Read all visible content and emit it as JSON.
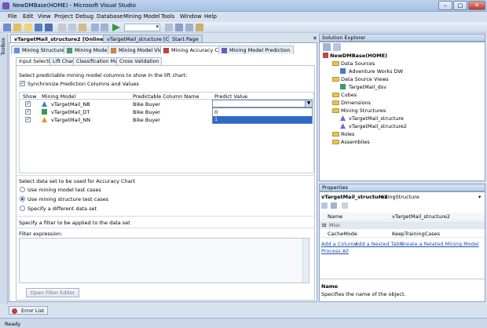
{
  "window": {
    "title": "NewDMBase(HOME) - Microsoft Visual Studio"
  },
  "menu": [
    "File",
    "Edit",
    "View",
    "Project",
    "Debug",
    "Database",
    "Mining Model",
    "Tools",
    "Window",
    "Help"
  ],
  "toolbox_label": "Toolbox",
  "doc_tabs": [
    {
      "label": "vTargetMail_structure2 [Online]",
      "active": true
    },
    {
      "label": "vTargetMail_structure [Online]",
      "active": false
    },
    {
      "label": "Start Page",
      "active": false
    }
  ],
  "designer_tabs": [
    "Mining Structure",
    "Mining Models",
    "Mining Model Viewer",
    "Mining Accuracy Chart",
    "Mining Model Prediction"
  ],
  "designer_active": "Mining Accuracy Chart",
  "sub_tabs": [
    "Input Selection",
    "Lift Chart",
    "Classification Matrix",
    "Cross Validation"
  ],
  "input": {
    "instruction": "Select predictable mining model columns to show in the lift chart:",
    "sync_label": "Synchronize Prediction Columns and Values",
    "columns": [
      "Show",
      "Mining Model",
      "Predictable Column Name",
      "Predict Value"
    ],
    "rows": [
      {
        "model": "vTargetMail_NB",
        "column": "Bike Buyer",
        "value": ""
      },
      {
        "model": "vTargetMail_DT",
        "column": "Bike Buyer",
        "value": ""
      },
      {
        "model": "vTargetMail_NN",
        "column": "Bike Buyer",
        "value": ""
      }
    ],
    "dropdown_options": [
      "0",
      "1"
    ],
    "dataset_heading": "Select data set to be used for Accuracy Chart",
    "dataset_options": [
      "Use mining model test cases",
      "Use mining structure test cases",
      "Specify a different data set"
    ],
    "dataset_selected": 1,
    "filter_heading": "Specify a filter to be applied to the data set",
    "filter_label": "Filter expression:",
    "filter_button": "Open Filter Editor"
  },
  "solution_explorer": {
    "title": "Solution Explorer",
    "items": [
      {
        "label": "NewDMBase(HOME)",
        "level": 0
      },
      {
        "label": "Data Sources",
        "level": 1
      },
      {
        "label": "Adventure Works DW",
        "level": 2
      },
      {
        "label": "Data Source Views",
        "level": 1
      },
      {
        "label": "TargetMail_dsv",
        "level": 2
      },
      {
        "label": "Cubes",
        "level": 1
      },
      {
        "label": "Dimensions",
        "level": 1
      },
      {
        "label": "Mining Structures",
        "level": 1
      },
      {
        "label": "vTargetMail_structure",
        "level": 2
      },
      {
        "label": "vTargetMail_structure2",
        "level": 2
      },
      {
        "label": "Roles",
        "level": 1
      },
      {
        "label": "Assemblies",
        "level": 1
      }
    ]
  },
  "properties": {
    "title": "Properties",
    "object": "vTargetMail_structure2",
    "object_type": "MiningStructure",
    "rows": [
      {
        "name": "Name",
        "value": "vTargetMail_structure2"
      },
      {
        "name": "Misc",
        "value": ""
      },
      {
        "name": "CacheMode",
        "value": "KeepTrainingCases"
      }
    ],
    "links": [
      "Add a Column",
      "Add a Nested Table",
      "Create a Related Mining Model",
      "Process All"
    ],
    "desc_title": "Name",
    "desc_text": "Specifies the name of the object."
  },
  "bottom_tab": "Error List",
  "status": "Ready"
}
